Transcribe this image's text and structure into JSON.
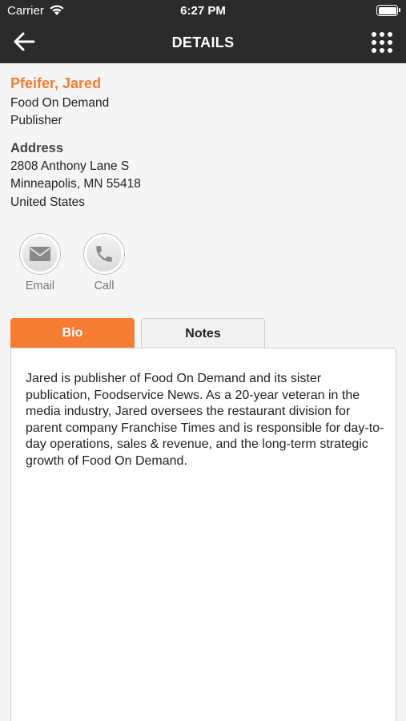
{
  "status_bar": {
    "carrier": "Carrier",
    "time": "6:27 PM"
  },
  "nav": {
    "title": "DETAILS",
    "back_icon": "back-arrow-icon",
    "menu_icon": "grid-menu-icon"
  },
  "contact": {
    "name": "Pfeifer, Jared",
    "company": "Food On Demand",
    "title": "Publisher",
    "address_heading": "Address",
    "address_lines": [
      "2808 Anthony Lane S",
      "Minneapolis, MN 55418",
      "United States"
    ]
  },
  "actions": {
    "email_label": "Email",
    "call_label": "Call"
  },
  "tabs": [
    {
      "label": "Bio",
      "selected": true
    },
    {
      "label": "Notes",
      "selected": false
    }
  ],
  "bio": "Jared is publisher of Food On Demand and its sister publication, Foodservice News. As a 20-year veteran in the media industry, Jared oversees the restaurant division for parent company Franchise Times and is responsible for day-to-day operations, sales & revenue, and the long-term strategic growth of Food On Demand.",
  "colors": {
    "accent": "#f57c33",
    "header_bg": "#2b2b2b",
    "background": "#f5f5f5"
  }
}
